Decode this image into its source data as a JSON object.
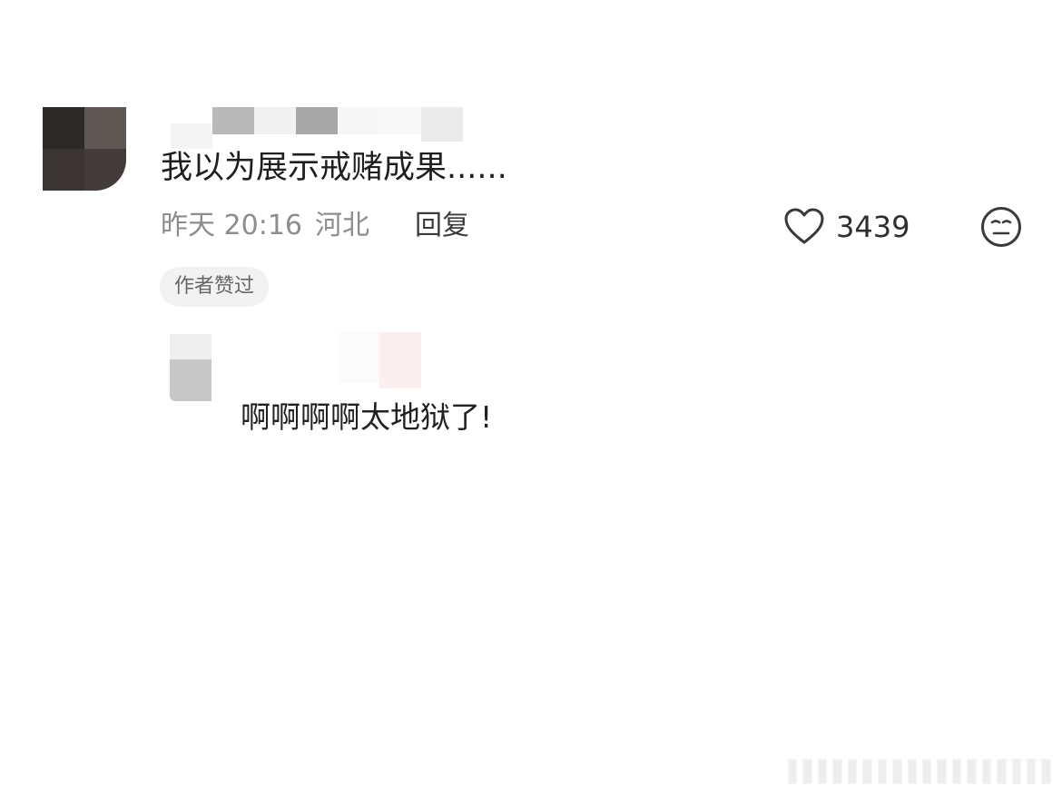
{
  "comment": {
    "text": "我以为展示戒赌成果......",
    "time": "昨天 20:16",
    "location": "河北",
    "reply_label": "回复",
    "like_count": "3439",
    "badge": "作者赞过"
  },
  "reply": {
    "text": "啊啊啊啊太地狱了!"
  },
  "colors": {
    "text_primary": "#1f1f1f",
    "text_meta": "#8d8d8d",
    "badge_bg": "#f2f2f2"
  },
  "icons": {
    "like": "heart-outline-icon",
    "reaction": "neutral-face-icon"
  }
}
